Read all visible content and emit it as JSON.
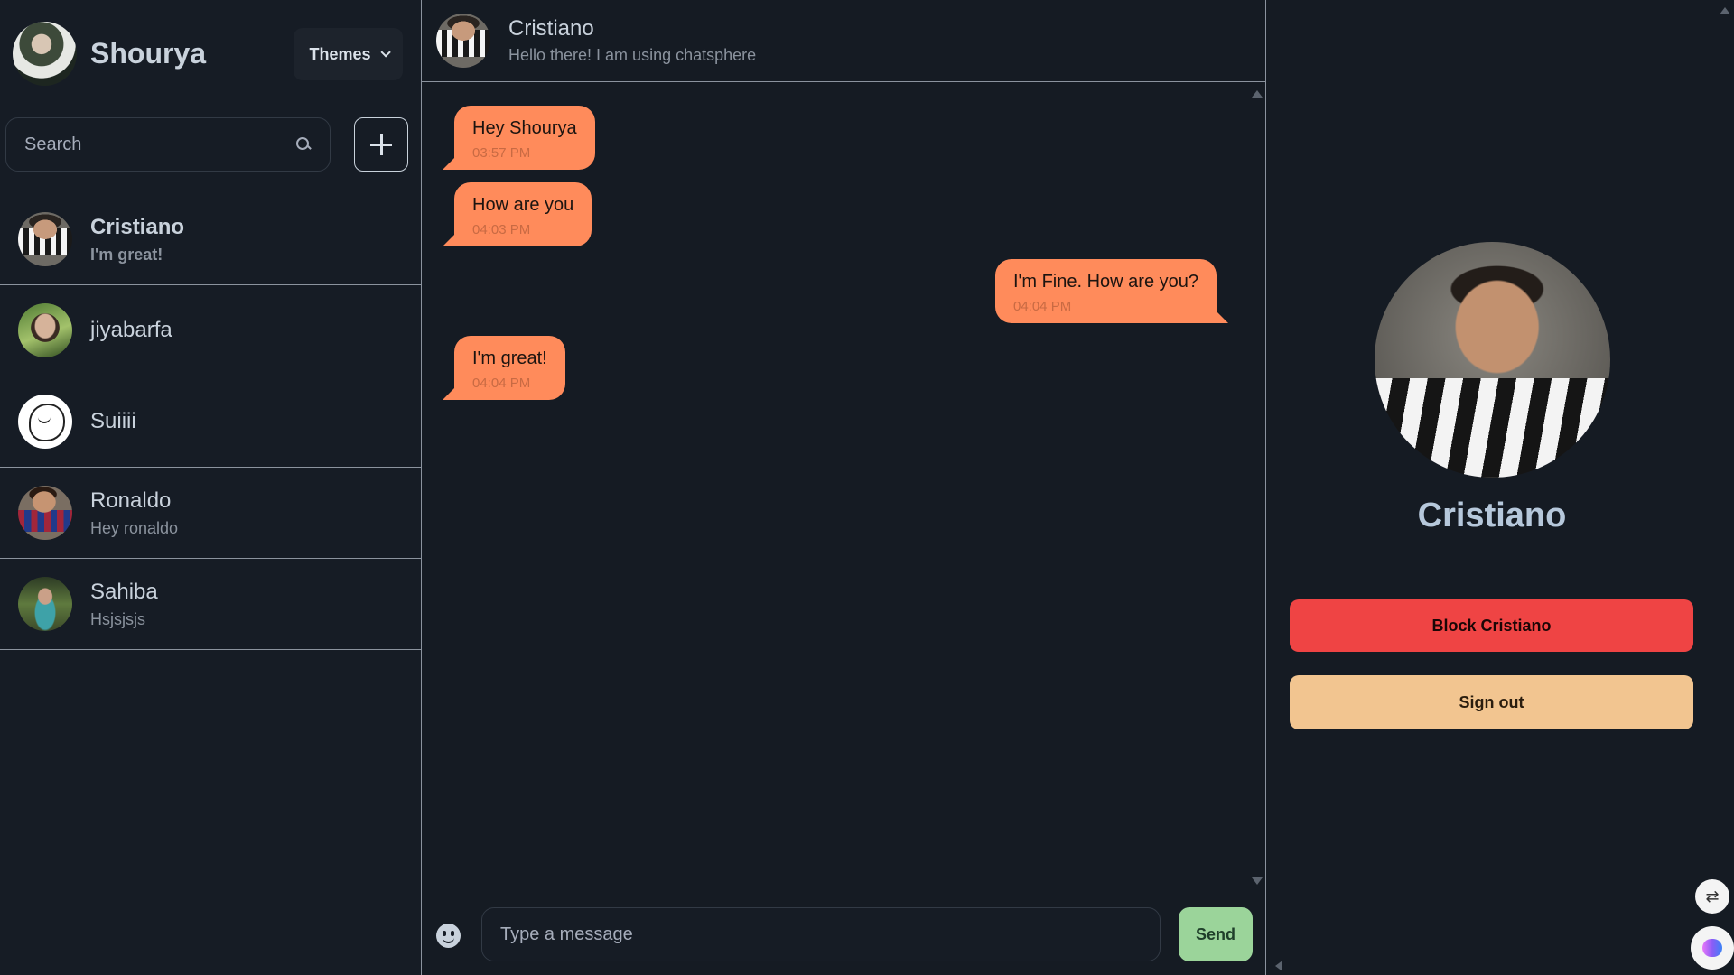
{
  "me": {
    "name": "Shourya"
  },
  "header": {
    "themes_label": "Themes"
  },
  "search": {
    "placeholder": "Search"
  },
  "contacts": [
    {
      "name": "Cristiano",
      "sub": "I'm great!"
    },
    {
      "name": "jiyabarfa",
      "sub": ""
    },
    {
      "name": "Suiiii",
      "sub": ""
    },
    {
      "name": "Ronaldo",
      "sub": "Hey ronaldo"
    },
    {
      "name": "Sahiba",
      "sub": "Hsjsjsjs"
    }
  ],
  "chat": {
    "name": "Cristiano",
    "status": "Hello there! I am using chatsphere",
    "messages": [
      {
        "text": "Hey Shourya",
        "time": "03:57 PM",
        "side": "left"
      },
      {
        "text": "How are you",
        "time": "04:03 PM",
        "side": "left"
      },
      {
        "text": "I'm Fine. How are you?",
        "time": "04:04 PM",
        "side": "right"
      },
      {
        "text": "I'm great!",
        "time": "04:04 PM",
        "side": "left"
      }
    ],
    "input_placeholder": "Type a message",
    "send_label": "Send"
  },
  "profile": {
    "name": "Cristiano",
    "block_label": "Block Cristiano",
    "signout_label": "Sign out"
  },
  "colors": {
    "bubble": "#ff8b5b",
    "block": "#ef4444",
    "signout": "#f2c590",
    "send": "#9bd49a"
  }
}
